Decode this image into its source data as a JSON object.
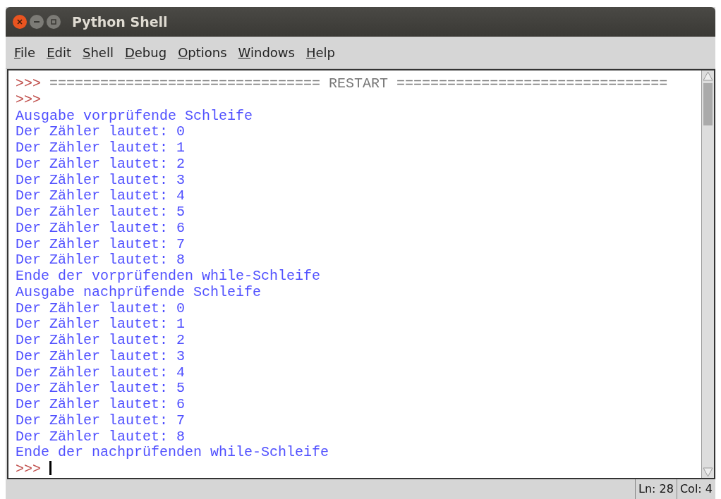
{
  "window": {
    "title": "Python Shell"
  },
  "menu": [
    {
      "label": "File"
    },
    {
      "label": "Edit"
    },
    {
      "label": "Shell"
    },
    {
      "label": "Debug"
    },
    {
      "label": "Options"
    },
    {
      "label": "Windows"
    },
    {
      "label": "Help"
    }
  ],
  "shell_lines": [
    {
      "kind": "restart",
      "prompt": ">>>",
      "text": "================================ RESTART ================================"
    },
    {
      "kind": "prompt",
      "prompt": ">>>"
    },
    {
      "kind": "output",
      "text": "Ausgabe vorprüfende Schleife"
    },
    {
      "kind": "output",
      "text": "Der Zähler lautet: 0"
    },
    {
      "kind": "output",
      "text": "Der Zähler lautet: 1"
    },
    {
      "kind": "output",
      "text": "Der Zähler lautet: 2"
    },
    {
      "kind": "output",
      "text": "Der Zähler lautet: 3"
    },
    {
      "kind": "output",
      "text": "Der Zähler lautet: 4"
    },
    {
      "kind": "output",
      "text": "Der Zähler lautet: 5"
    },
    {
      "kind": "output",
      "text": "Der Zähler lautet: 6"
    },
    {
      "kind": "output",
      "text": "Der Zähler lautet: 7"
    },
    {
      "kind": "output",
      "text": "Der Zähler lautet: 8"
    },
    {
      "kind": "output",
      "text": "Ende der vorprüfenden while-Schleife"
    },
    {
      "kind": "output",
      "text": "Ausgabe nachprüfende Schleife"
    },
    {
      "kind": "output",
      "text": "Der Zähler lautet: 0"
    },
    {
      "kind": "output",
      "text": "Der Zähler lautet: 1"
    },
    {
      "kind": "output",
      "text": "Der Zähler lautet: 2"
    },
    {
      "kind": "output",
      "text": "Der Zähler lautet: 3"
    },
    {
      "kind": "output",
      "text": "Der Zähler lautet: 4"
    },
    {
      "kind": "output",
      "text": "Der Zähler lautet: 5"
    },
    {
      "kind": "output",
      "text": "Der Zähler lautet: 6"
    },
    {
      "kind": "output",
      "text": "Der Zähler lautet: 7"
    },
    {
      "kind": "output",
      "text": "Der Zähler lautet: 8"
    },
    {
      "kind": "output",
      "text": "Ende der nachprüfenden while-Schleife"
    },
    {
      "kind": "cursor",
      "prompt": ">>>"
    }
  ],
  "status_bar": {
    "line": "Ln: 28",
    "column": "Col: 4"
  }
}
